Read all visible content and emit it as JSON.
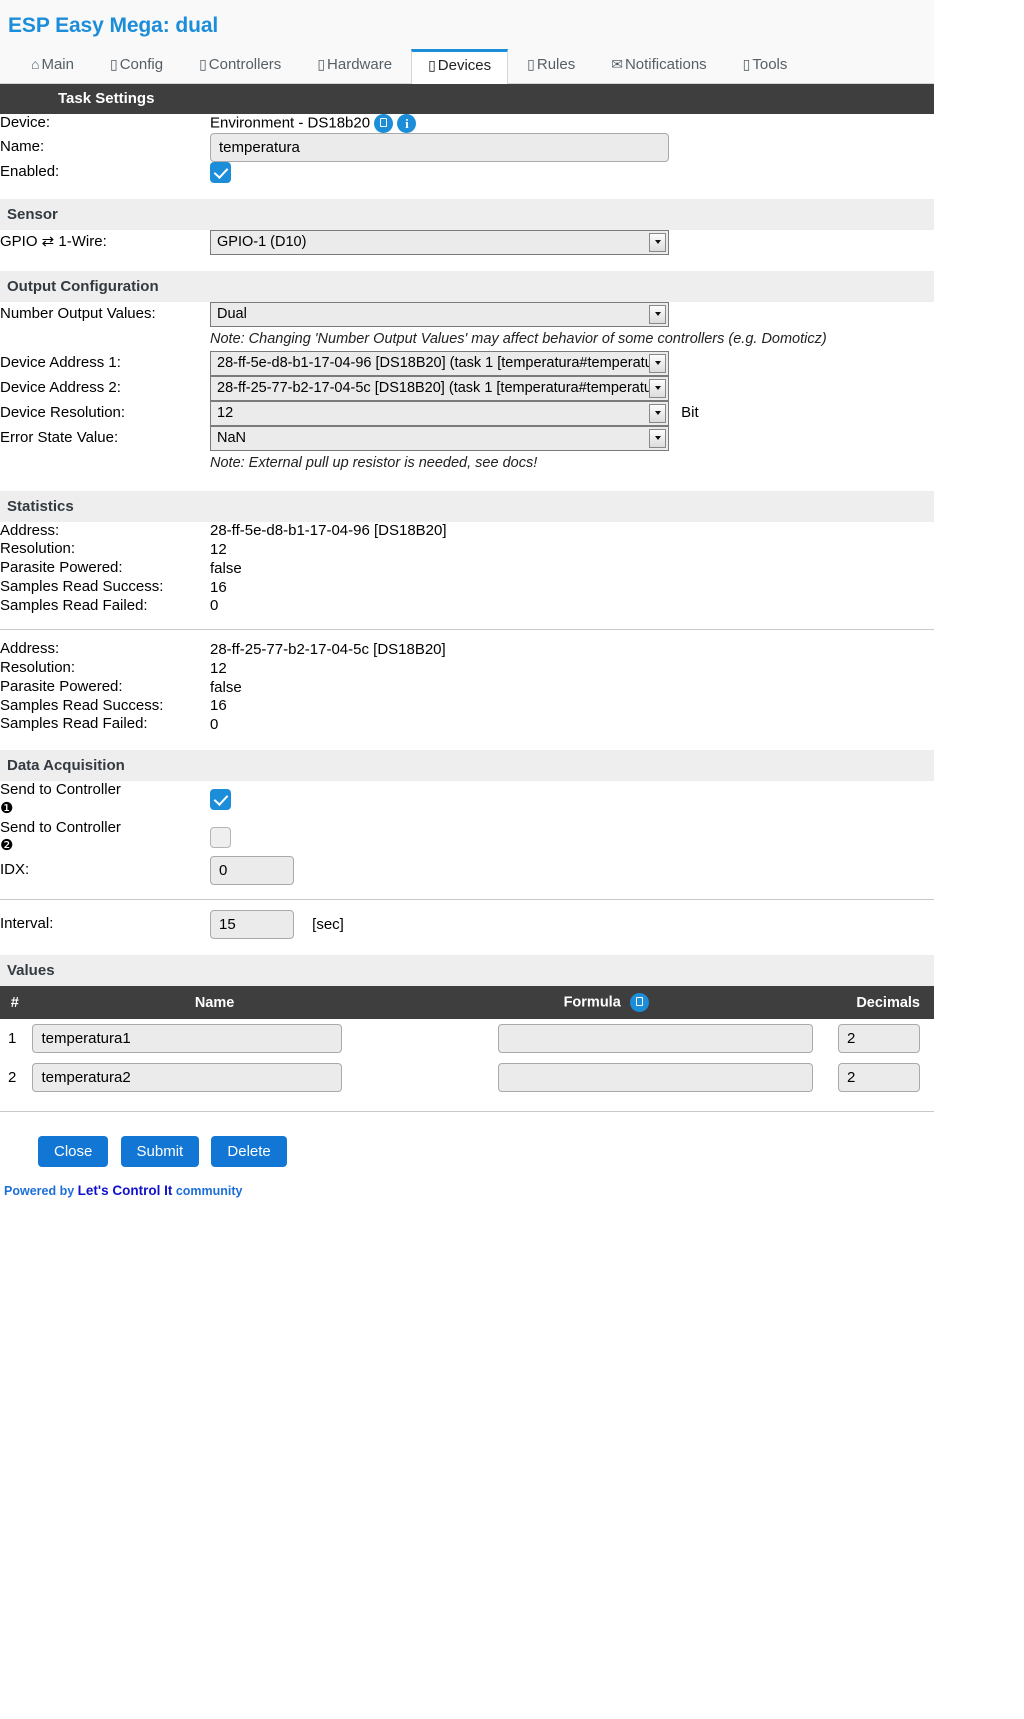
{
  "header": {
    "title": "ESP Easy Mega: dual",
    "tabs": [
      {
        "icon": "⌂",
        "label": "Main",
        "active": false
      },
      {
        "icon": "▯",
        "label": "Config",
        "active": false
      },
      {
        "icon": "▯",
        "label": "Controllers",
        "active": false
      },
      {
        "icon": "▯",
        "label": "Hardware",
        "active": false
      },
      {
        "icon": "▯",
        "label": "Devices",
        "active": true
      },
      {
        "icon": "▯",
        "label": "Rules",
        "active": false
      },
      {
        "icon": "✉",
        "label": "Notifications",
        "active": false
      },
      {
        "icon": "▯",
        "label": "Tools",
        "active": false
      }
    ]
  },
  "task_settings": {
    "section_title": "Task Settings",
    "device_label": "Device:",
    "device_value": "Environment - DS18b20",
    "copy_icon": "copy-icon",
    "info_icon": "i",
    "name_label": "Name:",
    "name_value": "temperatura",
    "enabled_label": "Enabled:",
    "enabled_checked": true
  },
  "sensor": {
    "section_title": "Sensor",
    "gpio_label": "GPIO ⇄ 1-Wire:",
    "gpio_value": "GPIO-1 (D10)"
  },
  "output_configuration": {
    "section_title": "Output Configuration",
    "number_output_label": "Number Output Values:",
    "number_output_value": "Dual",
    "note_outputs": "Note: Changing 'Number Output Values' may affect behavior of some controllers (e.g. Domoticz)",
    "address1_label": "Device Address 1:",
    "address1_value": "28-ff-5e-d8-b1-17-04-96 [DS18B20] (task 1 [temperatura#temperatu",
    "address2_label": "Device Address 2:",
    "address2_value": "28-ff-25-77-b2-17-04-5c [DS18B20] (task 1 [temperatura#temperatu",
    "resolution_label": "Device Resolution:",
    "resolution_value": "12",
    "resolution_unit": "Bit",
    "error_state_label": "Error State Value:",
    "error_state_value": "NaN",
    "note_pullup": "Note: External pull up resistor is needed, see docs!"
  },
  "statistics": {
    "section_title": "Statistics",
    "labels": {
      "address": "Address:",
      "resolution": "Resolution:",
      "parasite": "Parasite Powered:",
      "success": "Samples Read Success:",
      "failed": "Samples Read Failed:"
    },
    "blocks": [
      {
        "address": "28-ff-5e-d8-b1-17-04-96 [DS18B20]",
        "resolution": "12",
        "parasite": "false",
        "success": "16",
        "failed": "0"
      },
      {
        "address": "28-ff-25-77-b2-17-04-5c [DS18B20]",
        "resolution": "12",
        "parasite": "false",
        "success": "16",
        "failed": "0"
      }
    ]
  },
  "data_acquisition": {
    "section_title": "Data Acquisition",
    "controller1_label": "Send to Controller",
    "controller1_badge": "❶",
    "controller1_checked": true,
    "controller2_label": "Send to Controller",
    "controller2_badge": "❷",
    "controller2_checked": false,
    "idx_label": "IDX:",
    "idx_value": "0",
    "interval_label": "Interval:",
    "interval_value": "15",
    "interval_unit": "[sec]"
  },
  "values": {
    "section_title": "Values",
    "columns": {
      "idx": "#",
      "name": "Name",
      "formula": "Formula",
      "decimals": "Decimals"
    },
    "formula_copy_icon": "copy-icon",
    "rows": [
      {
        "idx": "1",
        "name": "temperatura1",
        "formula": "",
        "decimals": "2"
      },
      {
        "idx": "2",
        "name": "temperatura2",
        "formula": "",
        "decimals": "2"
      }
    ]
  },
  "buttons": {
    "close": "Close",
    "submit": "Submit",
    "delete": "Delete"
  },
  "footer": {
    "prefix": "Powered by ",
    "brand": "Let's Control It",
    "suffix": " community"
  },
  "colors": {
    "accent": "#1c8dd9",
    "button": "#1276d4",
    "dark_section": "#3e3e3e",
    "light_section": "#eeeeee"
  }
}
